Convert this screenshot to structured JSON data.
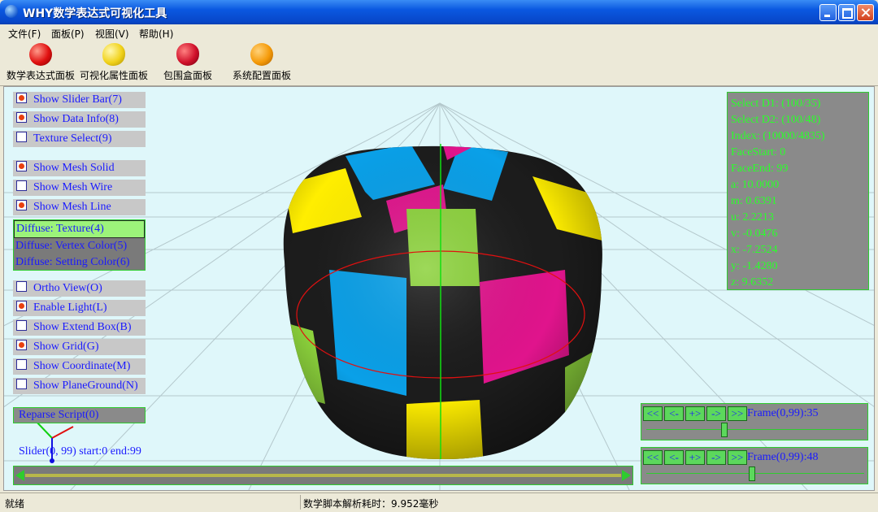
{
  "window": {
    "title": "WHY数学表达式可视化工具"
  },
  "menu": [
    "文件(F)",
    "面板(P)",
    "视图(V)",
    "帮助(H)"
  ],
  "toolbar": [
    {
      "label": "数学表达式面板",
      "icon": "apple-icon"
    },
    {
      "label": "可视化属性面板",
      "icon": "lemon-icon"
    },
    {
      "label": "包围盒面板",
      "icon": "strawberry-icon"
    },
    {
      "label": "系统配置面板",
      "icon": "orange-icon"
    }
  ],
  "options": {
    "slider_bar": {
      "label": "Show Slider Bar(7)",
      "checked": true
    },
    "data_info": {
      "label": "Show Data Info(8)",
      "checked": true
    },
    "texture_select": {
      "label": "Texture Select(9)",
      "checked": false
    },
    "mesh_solid": {
      "label": "Show Mesh Solid",
      "checked": true
    },
    "mesh_wire": {
      "label": "Show Mesh Wire",
      "checked": false
    },
    "mesh_line": {
      "label": "Show Mesh Line",
      "checked": true
    },
    "ortho": {
      "label": "Ortho View(O)",
      "checked": false
    },
    "light": {
      "label": "Enable Light(L)",
      "checked": true
    },
    "extend_box": {
      "label": "Show Extend Box(B)",
      "checked": false
    },
    "grid": {
      "label": "Show Grid(G)",
      "checked": true
    },
    "coordinate": {
      "label": "Show Coordinate(M)",
      "checked": false
    },
    "plane_ground": {
      "label": "Show PlaneGround(N)",
      "checked": false
    }
  },
  "diffuse": [
    "Diffuse: Texture(4)",
    "Diffuse: Vertex Color(5)",
    "Diffuse: Setting Color(6)"
  ],
  "diffuse_selected": 0,
  "reparse": "Reparse Script(0)",
  "slider_info": "Slider(0, 99) start:0 end:99",
  "data_info": [
    "Select D1: (100/35)",
    "Select D2: (100/48)",
    "Index: (10000/4835)",
    "FaceStart: 0",
    "FaceEnd: 99",
    "a: 10.0000",
    "m: 0.6391",
    "u: 2.2213",
    "v: -0.0476",
    "x: -7.2524",
    "y: -1.4280",
    "z: 9.6352"
  ],
  "frame_buttons": [
    "<<",
    "<-",
    "+>",
    "->",
    ">>"
  ],
  "frames": [
    {
      "label": "Frame(0,99):35",
      "value": 35,
      "max": 99
    },
    {
      "label": "Frame(0,99):48",
      "value": 48,
      "max": 99
    }
  ],
  "colors": {
    "green": "#2ecc2e",
    "label_blue": "#1a1aff",
    "info_green": "#2bff2b",
    "cyan": "#0aa0e8",
    "magenta": "#e0148c",
    "yellow": "#ffee00",
    "lime": "#8cd23c"
  },
  "status": {
    "left": "就绪",
    "right": "数学脚本解析耗时：9.952毫秒"
  }
}
